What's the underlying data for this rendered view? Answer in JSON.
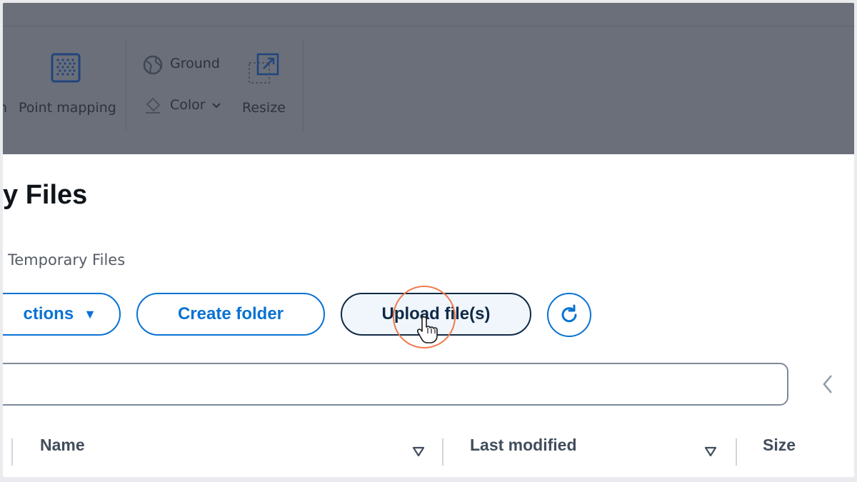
{
  "ribbon": {
    "items": {
      "cut_label": "n",
      "point_mapping_label": "Point mapping",
      "ground_label": "Ground",
      "color_label": "Color",
      "resize_label": "Resize"
    }
  },
  "page": {
    "title": "y Files",
    "breadcrumb": "Temporary Files"
  },
  "toolbar": {
    "actions_label": "ctions",
    "create_folder_label": "Create folder",
    "upload_label": "Upload file(s)"
  },
  "search": {
    "placeholder": ""
  },
  "table": {
    "columns": [
      "Name",
      "Last modified",
      "Size"
    ]
  },
  "colors": {
    "accent": "#0972d3",
    "dark_button": "#0f2a47",
    "highlight": "#ef7a4b",
    "overlay": "#6a6f79"
  }
}
